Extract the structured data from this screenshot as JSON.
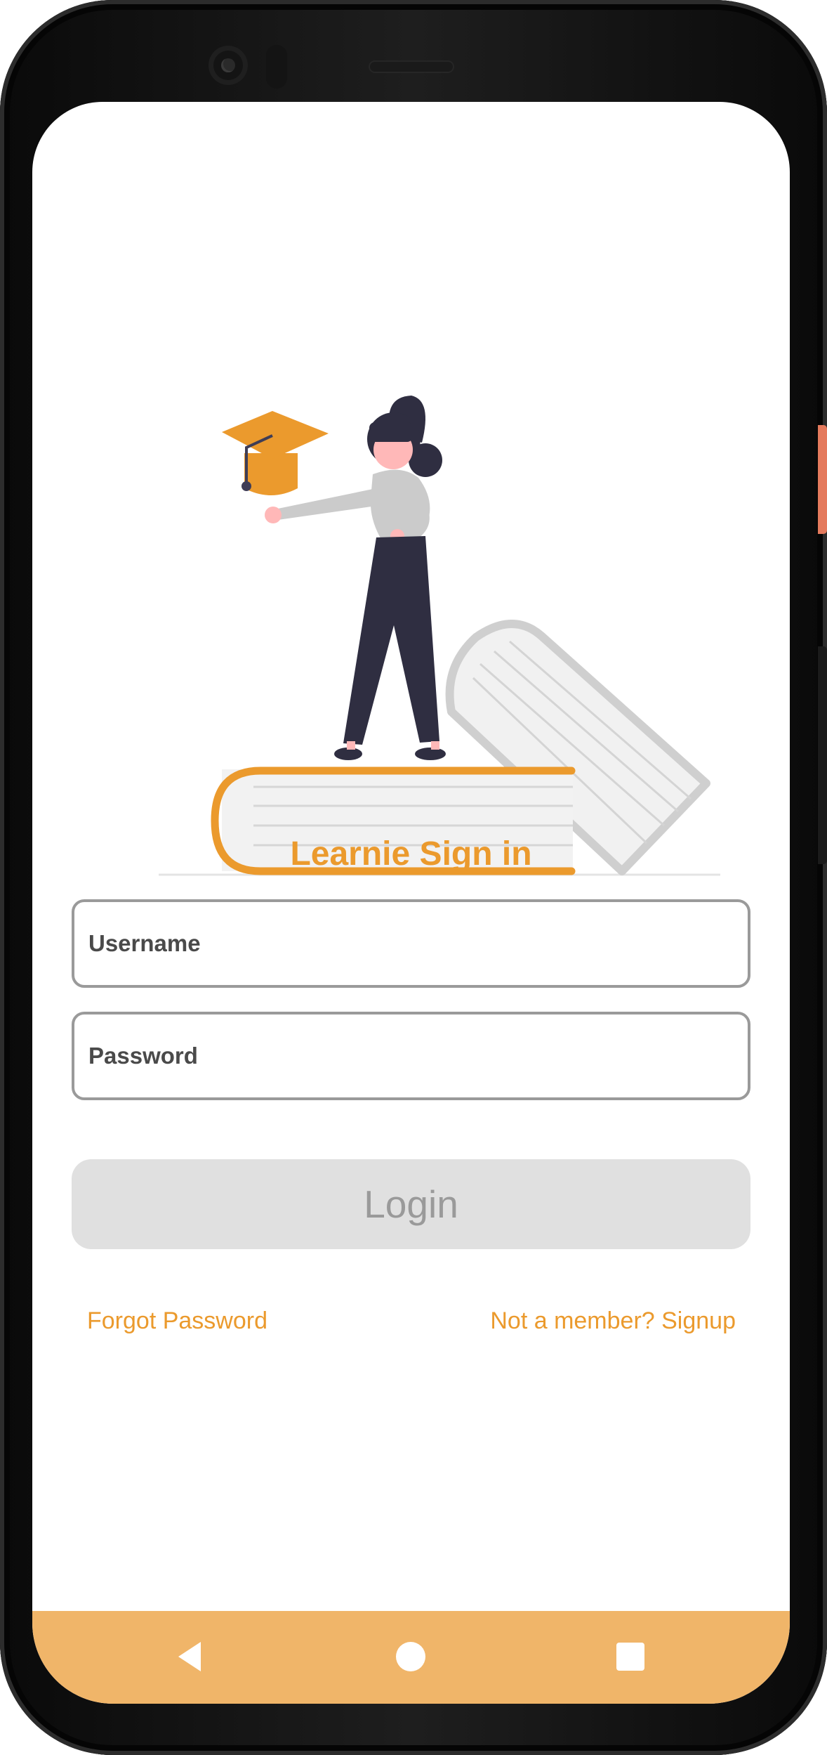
{
  "app": {
    "title": "Learnie Sign in"
  },
  "form": {
    "username_placeholder": "Username",
    "password_placeholder": "Password",
    "login_label": "Login"
  },
  "links": {
    "forgot_password": "Forgot Password",
    "signup": "Not a member? Signup"
  },
  "navbar": {
    "buttons": [
      "back-icon",
      "home-icon",
      "recent-apps-icon"
    ]
  },
  "colors": {
    "accent": "#eb9a2d",
    "navbar": "#f0b569",
    "button_disabled_bg": "#e0e0e0",
    "button_disabled_text": "#9a9a9a",
    "field_border": "#9a9a9a"
  }
}
